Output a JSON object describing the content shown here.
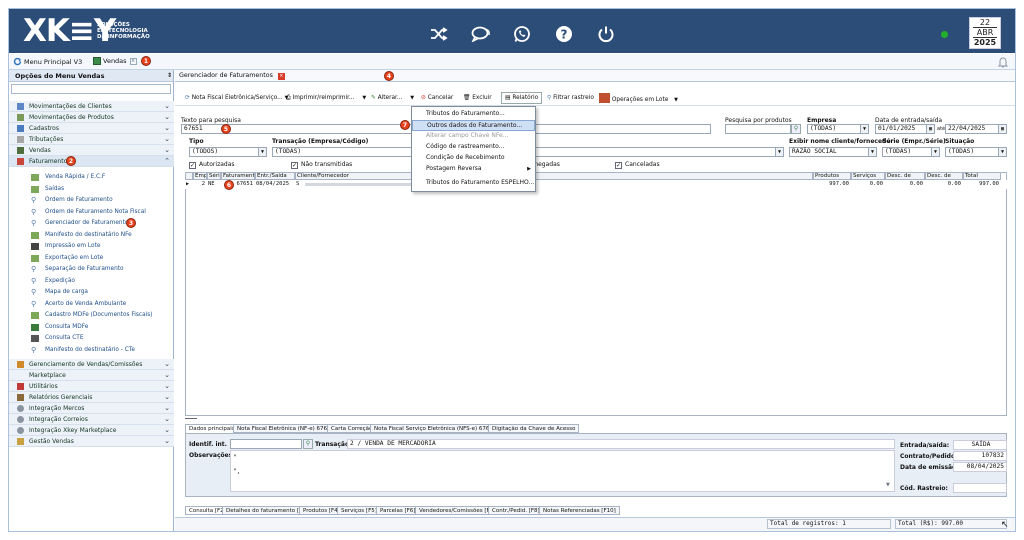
{
  "header": {
    "logo_text": "XK≡Y",
    "logo_sub": [
      "SOLUÇÕES",
      "EM TECNOLOGIA",
      "DA INFORMAÇÃO"
    ],
    "date_day": "22",
    "date_month": "ABR",
    "date_year": "2025",
    "brand_color": "#2b4d78",
    "icons": [
      "shuffle-icon",
      "chat-icon",
      "whatsapp-icon",
      "help-icon",
      "power-icon"
    ]
  },
  "top_tabs": [
    {
      "label": "Menu Principal V3"
    },
    {
      "label": "Vendas"
    }
  ],
  "badges": {
    "b1": "1",
    "b2": "2",
    "b3": "3",
    "b4": "4",
    "b5": "5",
    "b6": "6",
    "b7": "7"
  },
  "sidebar": {
    "title": "Opções do Menu Vendas",
    "groups": [
      "Movimentações de Clientes",
      "Movimentações de Produtos",
      "Cadastros",
      "Tributações",
      "Vendas",
      "Faturamento"
    ],
    "sub_items": [
      "Venda Rápida / E.C.F",
      "Saídas",
      "Ordem de Faturamento",
      "Ordem de Faturamento Nota Fiscal",
      "Gerenciador de Faturamento",
      "Manifesto do destinatário NFe",
      "Impressão em Lote",
      "Exportação em Lote",
      "Separação de Faturamento",
      "Expedição",
      "Mapa de carga",
      "Acerto de Venda Ambulante",
      "Cadastro MDFe (Documentos Fiscais)",
      "Consulta MDFe",
      "Consulta CTE",
      "Manifesto do destinatário - CTe"
    ],
    "groups2": [
      "Gerenciamento de Vendas/Comissões",
      "Marketplace",
      "Utilitários",
      "Relatórios Gerenciais",
      "Integração Mercos",
      "Integração Correios",
      "Integração Xkey Marketplace",
      "Gestão Vendas"
    ]
  },
  "main": {
    "tab_title": "Gerenciador de Faturamentos",
    "toolbar": {
      "nf": "Nota Fiscal Eletrônica/Serviço...",
      "print": "Imprimir/reimprimir...",
      "alterar": "Alterar...",
      "cancelar": "Cancelar",
      "excluir": "Excluir",
      "relatorio": "Relatório",
      "filtrar": "Filtrar rastreio",
      "lote": "Operações em Lote"
    },
    "filters": {
      "texto_label": "Texto para pesquisa",
      "texto_value": "67651",
      "pesq_prod_label": "Pesquisa por produtos",
      "empresa_label": "Empresa",
      "empresa_value": "(TODAS)",
      "data_label": "Data de entrada/saída",
      "data_ini": "01/01/2025",
      "ate": "até",
      "data_fim": "22/04/2025",
      "tipo_label": "Tipo",
      "tipo_value": "(TODOS)",
      "transacao_label": "Transação (Empresa/Código)",
      "transacao_value": "(TODAS)",
      "exibir_label": "Exibir nome cliente/fornecedor",
      "exibir_value": "RAZÃO SOCIAL",
      "serie_label": "Série (Empr./Série)",
      "serie_value": "(TODAS)",
      "situacao_label": "Situação",
      "situacao_value": "(TODAS)",
      "cb_autorizadas": "Autorizadas",
      "cb_nao_transmitidas": "Não transmitidas",
      "cb_denegadas": "Denegadas",
      "cb_canceladas": "Canceladas"
    },
    "grid": {
      "headers": [
        "Emp",
        "Série",
        "Faturamento",
        "Entr./Saída",
        "Cliente/Fornecedor",
        "Produtos",
        "Serviços",
        "Desc. de prod",
        "Desc. de serv.",
        "Total"
      ],
      "row": [
        "2",
        "NE",
        "67651",
        "08/04/2025",
        "S",
        "997.00",
        "0.00",
        "0.00",
        "0.00",
        "997.00"
      ]
    },
    "context_menu": [
      "Tributos do Faturamento...",
      "Outros dados do Faturamento...",
      "Alterar campo Chave NFe...",
      "Código de rastreamento...",
      "Condição de Recebimento",
      "Postagem Reversa",
      "Tributos do Faturamento ESPELHO..."
    ],
    "detail_tabs": [
      "Dados principais",
      "Nota Fiscal Eletrônica (NF-e) 67651",
      "Carta Correção",
      "Nota Fiscal Serviço Eletrônica (NFS-e) 67651",
      "Digitação da Chave de Acesso"
    ],
    "detail": {
      "ident_label": "Identif. int.",
      "transacao_label": "Transação:",
      "transacao_value": "2 /  VENDA DE MERCADORIA",
      "obs_label": "Observações:",
      "obs_line1": "\"",
      "obs_line2": "\",",
      "entrada_label": "Entrada/saída:",
      "entrada_value": "SAÍDA",
      "contrato_label": "Contrato/Pedido:",
      "contrato_value": "107832",
      "emissao_label": "Data de emissão:",
      "emissao_value": "08/04/2025",
      "rastreio_label": "Cód. Rastreio:"
    },
    "bottom_tabs": [
      "Consulta [F2]",
      "Detalhes do faturamento [F3]",
      "Produtos [F4]",
      "Serviços [F5]",
      "Parcelas [F6]",
      "Vendedores/Comissões [F7]",
      "Contr./Pedid. [F8]",
      "Notas Referenciadas [F10]"
    ],
    "status": {
      "total_registros": "Total de registros: 1",
      "total_rs": "Total (R$): 997.00"
    }
  }
}
